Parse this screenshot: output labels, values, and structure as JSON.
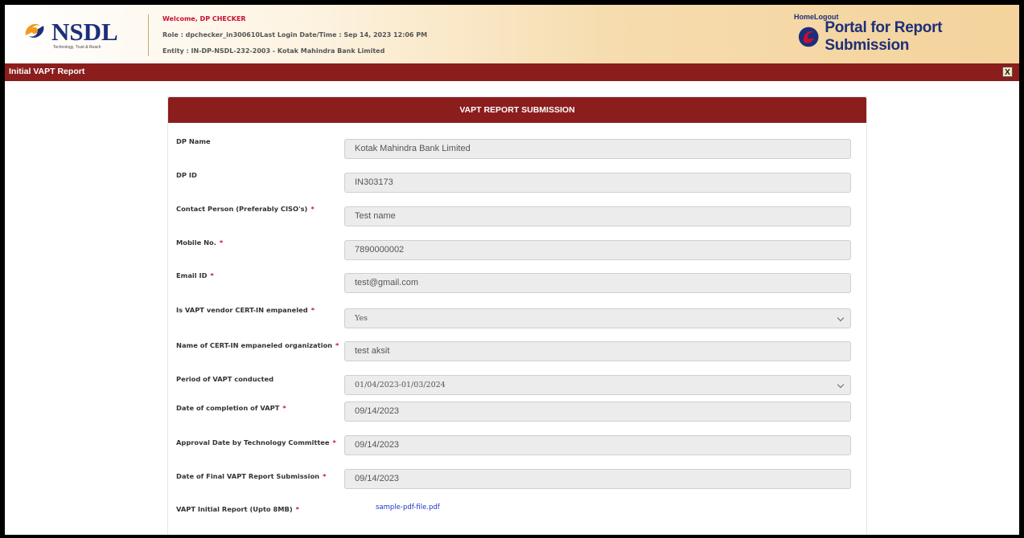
{
  "header": {
    "logo_text": "NSDL",
    "logo_tagline": "Technology, Trust & Reach",
    "welcome_label": "Welcome,",
    "welcome_name": "DP CHECKER",
    "role_line": "Role : dpchecker_in300610Last Login Date/Time : Sep 14, 2023 12:06 PM",
    "entity_line": "Entity : IN-DP-NSDL-232-2003 - Kotak Mahindra Bank Limited",
    "home_link": "Home",
    "logout_link": "Logout",
    "portal_title": "Portal for Report Submission"
  },
  "titlebar": {
    "title": "Initial VAPT Report",
    "close_label": "X"
  },
  "form": {
    "heading": "VAPT REPORT SUBMISSION",
    "fields": [
      {
        "label": "DP Name",
        "required": false,
        "value": "Kotak Mahindra Bank Limited",
        "type": "text"
      },
      {
        "label": "DP ID",
        "required": false,
        "value": "IN303173",
        "type": "text"
      },
      {
        "label": "Contact Person (Preferably CISO's)",
        "required": true,
        "value": "Test name",
        "type": "text"
      },
      {
        "label": "Mobile No.",
        "required": true,
        "value": "7890000002",
        "type": "text"
      },
      {
        "label": "Email ID",
        "required": true,
        "value": "test@gmail.com",
        "type": "text"
      },
      {
        "label": "Is VAPT vendor CERT-IN empaneled",
        "required": true,
        "value": "Yes",
        "type": "select"
      },
      {
        "label": "Name of CERT-IN empaneled organization",
        "required": true,
        "value": "test aksit",
        "type": "text"
      },
      {
        "label": "Period of VAPT conducted",
        "required": false,
        "value": "01/04/2023-01/03/2024",
        "type": "select"
      },
      {
        "label": "Date of completion of VAPT",
        "required": true,
        "value": "09/14/2023",
        "type": "text"
      },
      {
        "label": "Approval Date by Technology Committee",
        "required": true,
        "value": "09/14/2023",
        "type": "text"
      },
      {
        "label": "Date of Final VAPT Report Submission",
        "required": true,
        "value": "09/14/2023",
        "type": "text"
      },
      {
        "label": "VAPT Initial Report (Upto 8MB)",
        "required": true,
        "value": "sample-pdf-file.pdf",
        "type": "file"
      }
    ]
  },
  "colors": {
    "brand_maroon": "#8b1d1d",
    "brand_navy": "#1d2f7a",
    "required_red": "#d0112b"
  }
}
